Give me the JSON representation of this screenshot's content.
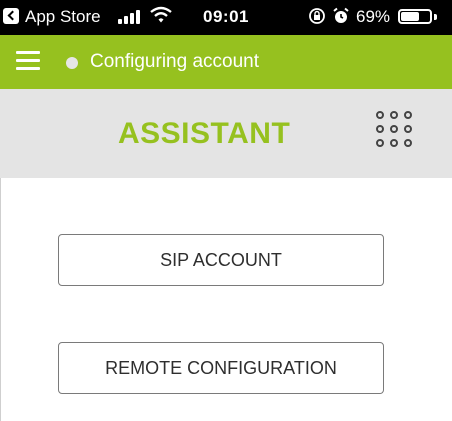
{
  "status_bar": {
    "back_app": "App Store",
    "time": "09:01",
    "battery_percent": "69%",
    "battery_level": 0.69,
    "signal_bars": 4
  },
  "top_bar": {
    "status_text": "Configuring account",
    "status_dot_color": "#e6e6e6",
    "accent_color": "#96c11f",
    "menu_icon": "hamburger-menu-icon"
  },
  "header": {
    "title": "ASSISTANT",
    "grid_icon": "dial-pad-icon"
  },
  "main": {
    "buttons": [
      {
        "label": "SIP ACCOUNT"
      },
      {
        "label": "REMOTE CONFIGURATION"
      }
    ]
  }
}
